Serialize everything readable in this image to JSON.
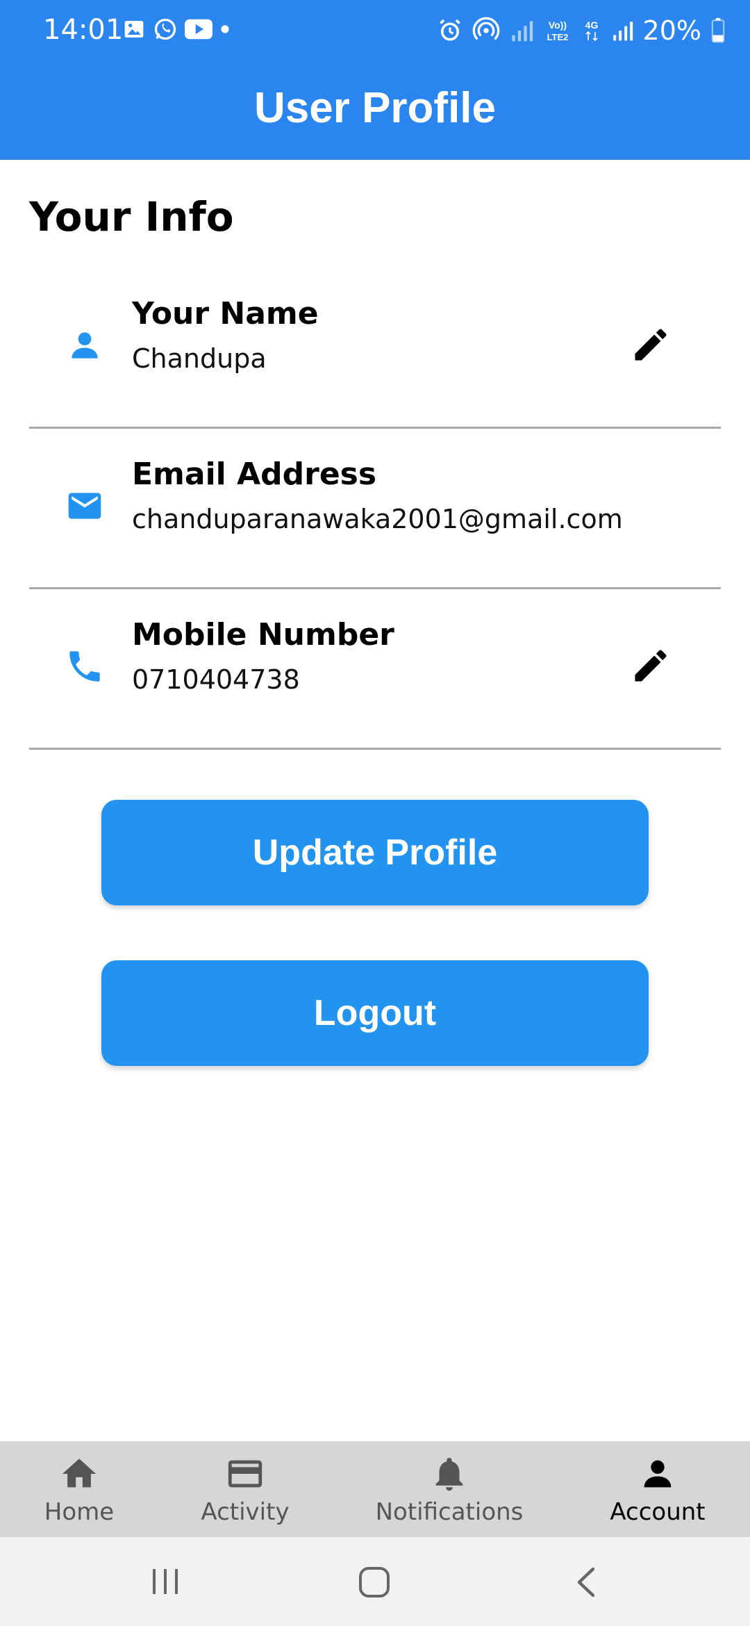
{
  "status_bar": {
    "time": "14:01",
    "battery": "20%"
  },
  "header": {
    "title": "User Profile"
  },
  "section": {
    "title": "Your Info"
  },
  "fields": [
    {
      "label": "Your Name",
      "value": "Chandupa",
      "icon": "person-icon",
      "editable": true
    },
    {
      "label": "Email Address",
      "value": "chanduparanawaka2001@gmail.com",
      "icon": "email-icon",
      "editable": false
    },
    {
      "label": "Mobile Number",
      "value": "0710404738",
      "icon": "phone-icon",
      "editable": true
    }
  ],
  "buttons": {
    "update": "Update Profile",
    "logout": "Logout"
  },
  "bottom_nav": {
    "items": [
      {
        "label": "Home",
        "icon": "home-icon"
      },
      {
        "label": "Activity",
        "icon": "card-icon"
      },
      {
        "label": "Notifications",
        "icon": "bell-icon"
      },
      {
        "label": "Account",
        "icon": "account-icon",
        "active": true
      }
    ]
  },
  "colors": {
    "primary": "#2a86ee",
    "button": "#2294f0",
    "icon": "#2294f0",
    "nav_bg": "#d6d6d6"
  }
}
